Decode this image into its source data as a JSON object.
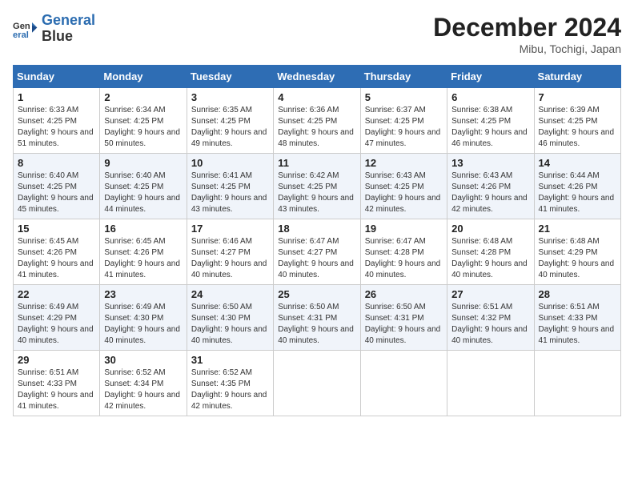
{
  "header": {
    "logo_line1": "General",
    "logo_line2": "Blue",
    "month_title": "December 2024",
    "location": "Mibu, Tochigi, Japan"
  },
  "weekdays": [
    "Sunday",
    "Monday",
    "Tuesday",
    "Wednesday",
    "Thursday",
    "Friday",
    "Saturday"
  ],
  "weeks": [
    [
      {
        "day": "1",
        "sunrise": "6:33 AM",
        "sunset": "4:25 PM",
        "daylight": "9 hours and 51 minutes."
      },
      {
        "day": "2",
        "sunrise": "6:34 AM",
        "sunset": "4:25 PM",
        "daylight": "9 hours and 50 minutes."
      },
      {
        "day": "3",
        "sunrise": "6:35 AM",
        "sunset": "4:25 PM",
        "daylight": "9 hours and 49 minutes."
      },
      {
        "day": "4",
        "sunrise": "6:36 AM",
        "sunset": "4:25 PM",
        "daylight": "9 hours and 48 minutes."
      },
      {
        "day": "5",
        "sunrise": "6:37 AM",
        "sunset": "4:25 PM",
        "daylight": "9 hours and 47 minutes."
      },
      {
        "day": "6",
        "sunrise": "6:38 AM",
        "sunset": "4:25 PM",
        "daylight": "9 hours and 46 minutes."
      },
      {
        "day": "7",
        "sunrise": "6:39 AM",
        "sunset": "4:25 PM",
        "daylight": "9 hours and 46 minutes."
      }
    ],
    [
      {
        "day": "8",
        "sunrise": "6:40 AM",
        "sunset": "4:25 PM",
        "daylight": "9 hours and 45 minutes."
      },
      {
        "day": "9",
        "sunrise": "6:40 AM",
        "sunset": "4:25 PM",
        "daylight": "9 hours and 44 minutes."
      },
      {
        "day": "10",
        "sunrise": "6:41 AM",
        "sunset": "4:25 PM",
        "daylight": "9 hours and 43 minutes."
      },
      {
        "day": "11",
        "sunrise": "6:42 AM",
        "sunset": "4:25 PM",
        "daylight": "9 hours and 43 minutes."
      },
      {
        "day": "12",
        "sunrise": "6:43 AM",
        "sunset": "4:25 PM",
        "daylight": "9 hours and 42 minutes."
      },
      {
        "day": "13",
        "sunrise": "6:43 AM",
        "sunset": "4:26 PM",
        "daylight": "9 hours and 42 minutes."
      },
      {
        "day": "14",
        "sunrise": "6:44 AM",
        "sunset": "4:26 PM",
        "daylight": "9 hours and 41 minutes."
      }
    ],
    [
      {
        "day": "15",
        "sunrise": "6:45 AM",
        "sunset": "4:26 PM",
        "daylight": "9 hours and 41 minutes."
      },
      {
        "day": "16",
        "sunrise": "6:45 AM",
        "sunset": "4:26 PM",
        "daylight": "9 hours and 41 minutes."
      },
      {
        "day": "17",
        "sunrise": "6:46 AM",
        "sunset": "4:27 PM",
        "daylight": "9 hours and 40 minutes."
      },
      {
        "day": "18",
        "sunrise": "6:47 AM",
        "sunset": "4:27 PM",
        "daylight": "9 hours and 40 minutes."
      },
      {
        "day": "19",
        "sunrise": "6:47 AM",
        "sunset": "4:28 PM",
        "daylight": "9 hours and 40 minutes."
      },
      {
        "day": "20",
        "sunrise": "6:48 AM",
        "sunset": "4:28 PM",
        "daylight": "9 hours and 40 minutes."
      },
      {
        "day": "21",
        "sunrise": "6:48 AM",
        "sunset": "4:29 PM",
        "daylight": "9 hours and 40 minutes."
      }
    ],
    [
      {
        "day": "22",
        "sunrise": "6:49 AM",
        "sunset": "4:29 PM",
        "daylight": "9 hours and 40 minutes."
      },
      {
        "day": "23",
        "sunrise": "6:49 AM",
        "sunset": "4:30 PM",
        "daylight": "9 hours and 40 minutes."
      },
      {
        "day": "24",
        "sunrise": "6:50 AM",
        "sunset": "4:30 PM",
        "daylight": "9 hours and 40 minutes."
      },
      {
        "day": "25",
        "sunrise": "6:50 AM",
        "sunset": "4:31 PM",
        "daylight": "9 hours and 40 minutes."
      },
      {
        "day": "26",
        "sunrise": "6:50 AM",
        "sunset": "4:31 PM",
        "daylight": "9 hours and 40 minutes."
      },
      {
        "day": "27",
        "sunrise": "6:51 AM",
        "sunset": "4:32 PM",
        "daylight": "9 hours and 40 minutes."
      },
      {
        "day": "28",
        "sunrise": "6:51 AM",
        "sunset": "4:33 PM",
        "daylight": "9 hours and 41 minutes."
      }
    ],
    [
      {
        "day": "29",
        "sunrise": "6:51 AM",
        "sunset": "4:33 PM",
        "daylight": "9 hours and 41 minutes."
      },
      {
        "day": "30",
        "sunrise": "6:52 AM",
        "sunset": "4:34 PM",
        "daylight": "9 hours and 42 minutes."
      },
      {
        "day": "31",
        "sunrise": "6:52 AM",
        "sunset": "4:35 PM",
        "daylight": "9 hours and 42 minutes."
      },
      null,
      null,
      null,
      null
    ]
  ]
}
